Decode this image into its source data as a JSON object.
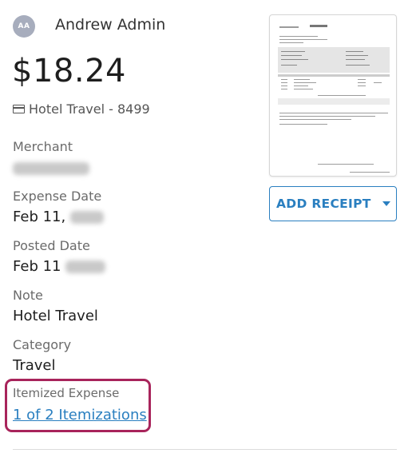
{
  "user": {
    "initials": "AA",
    "name": "Andrew Admin"
  },
  "expense": {
    "amount": "$18.24",
    "card_label": "Hotel Travel - 8499"
  },
  "fields": {
    "merchant": {
      "label": "Merchant",
      "value": ""
    },
    "expense_date": {
      "label": "Expense Date",
      "value": "Feb 11,"
    },
    "posted_date": {
      "label": "Posted Date",
      "value": "Feb 11"
    },
    "note": {
      "label": "Note",
      "value": "Hotel Travel"
    },
    "category": {
      "label": "Category",
      "value": "Travel"
    },
    "itemized": {
      "label": "Itemized Expense",
      "link": "1 of 2 Itemizations"
    }
  },
  "receipt": {
    "add_label": "ADD RECEIPT"
  },
  "colors": {
    "accent": "#2a7fc0",
    "highlight": "#a8245b",
    "avatar_bg": "#a7adbd"
  },
  "icons": {
    "card": "credit-card-icon",
    "dropdown": "chevron-down-icon"
  }
}
